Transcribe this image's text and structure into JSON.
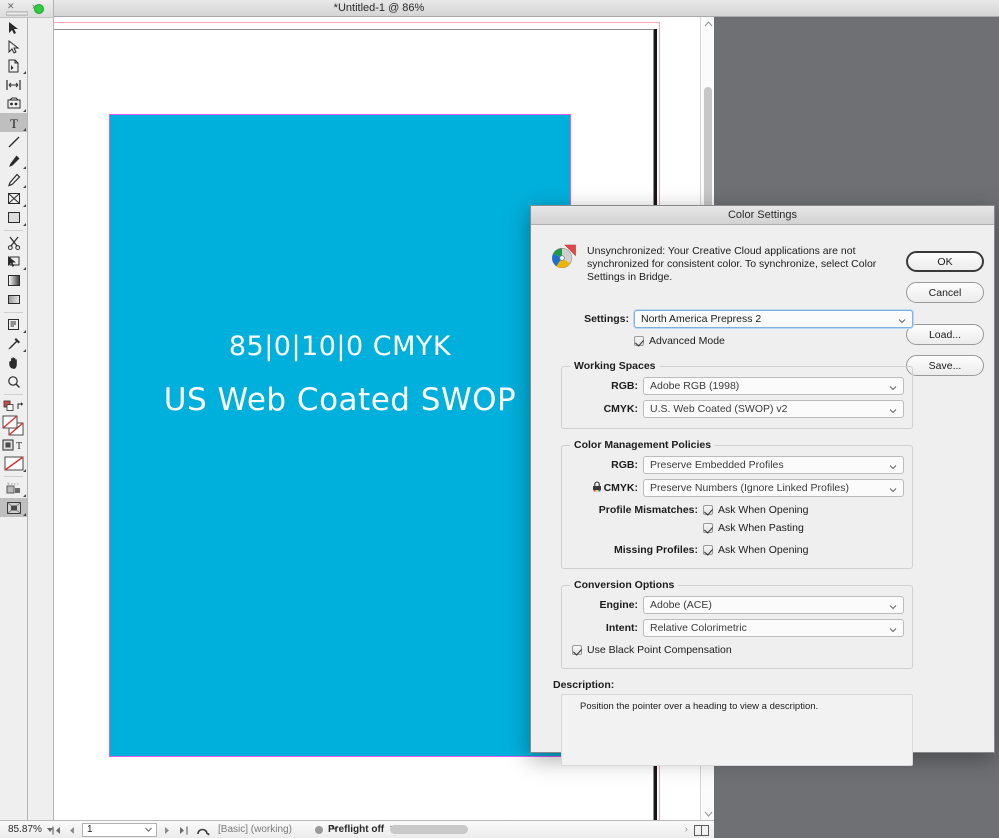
{
  "window": {
    "title": "*Untitled-1 @ 86%",
    "close_dot": "green-close-dot",
    "panel_collapse_x": "✕",
    "panel_expand": "»"
  },
  "canvas": {
    "artwork_line1": "85|0|10|0 CMYK",
    "artwork_line2": "US Web Coated SWOP",
    "rect_color": "#00b0dc",
    "selection_color": "#e45bf0",
    "bleed_color": "#f7a8b2"
  },
  "toolbar": {
    "items": [
      {
        "name": "selection-tool",
        "selected": false
      },
      {
        "name": "direct-selection-tool",
        "selected": false
      },
      {
        "name": "page-tool",
        "selected": false
      },
      {
        "name": "gap-tool",
        "selected": false
      },
      {
        "name": "content-collector-tool",
        "selected": false
      },
      {
        "name": "type-tool",
        "selected": true
      },
      {
        "name": "line-tool",
        "selected": false
      },
      {
        "name": "pen-tool",
        "selected": false
      },
      {
        "name": "pencil-tool",
        "selected": false
      },
      {
        "name": "frame-tool",
        "selected": false
      },
      {
        "name": "rectangle-tool",
        "selected": false
      },
      {
        "name": "scissors-tool",
        "selected": false
      },
      {
        "name": "free-transform-tool",
        "selected": false
      },
      {
        "name": "gradient-swatch-tool",
        "selected": false
      },
      {
        "name": "gradient-feather-tool",
        "selected": false
      },
      {
        "name": "note-tool",
        "selected": false
      },
      {
        "name": "eyedropper-tool",
        "selected": false
      },
      {
        "name": "hand-tool",
        "selected": false
      },
      {
        "name": "zoom-tool",
        "selected": false
      },
      {
        "name": "fill-stroke-swap",
        "selected": false
      },
      {
        "name": "fill-stroke-proxy",
        "selected": false
      },
      {
        "name": "formatting-affects-container",
        "selected": false
      },
      {
        "name": "apply-none-swatch",
        "selected": false
      },
      {
        "name": "normal-view-mode",
        "selected": false
      },
      {
        "name": "preview-mode",
        "selected": true
      }
    ]
  },
  "statusbar": {
    "zoom": "85.87%",
    "first_page": "⏮",
    "prev_page": "◀",
    "page_value": "1",
    "next_page": "▶",
    "last_page": "⏭",
    "style_label": "[Basic] (working)",
    "preflight": "Preflight off",
    "overflow": "‹"
  },
  "dialog": {
    "title": "Color Settings",
    "alert_icon": "color-wheel-icon",
    "alert_text": "Unsynchronized: Your Creative Cloud applications are not synchronized for consistent color. To synchronize, select Color Settings in Bridge.",
    "buttons": {
      "ok": "OK",
      "cancel": "Cancel",
      "load": "Load...",
      "save": "Save..."
    },
    "settings": {
      "label": "Settings:",
      "value": "North America Prepress 2",
      "advanced_mode_label": "Advanced Mode",
      "advanced_mode_checked": true
    },
    "working_spaces": {
      "legend": "Working Spaces",
      "rgb_label": "RGB:",
      "rgb_value": "Adobe RGB (1998)",
      "cmyk_label": "CMYK:",
      "cmyk_value": "U.S. Web Coated (SWOP) v2"
    },
    "color_management_policies": {
      "legend": "Color Management Policies",
      "rgb_label": "RGB:",
      "rgb_value": "Preserve Embedded Profiles",
      "cmyk_label": "CMYK:",
      "cmyk_value": "Preserve Numbers (Ignore Linked Profiles)",
      "cmyk_lock_icon": "lock-icon",
      "profile_mismatches_label": "Profile Mismatches:",
      "ask_when_opening_1": "Ask When Opening",
      "ask_when_opening_1_checked": true,
      "ask_when_pasting": "Ask When Pasting",
      "ask_when_pasting_checked": true,
      "missing_profiles_label": "Missing Profiles:",
      "ask_when_opening_2": "Ask When Opening",
      "ask_when_opening_2_checked": true
    },
    "conversion_options": {
      "legend": "Conversion Options",
      "engine_label": "Engine:",
      "engine_value": "Adobe (ACE)",
      "intent_label": "Intent:",
      "intent_value": "Relative Colorimetric",
      "bpc_label": "Use Black Point Compensation",
      "bpc_checked": true
    },
    "description": {
      "label": "Description:",
      "text": "Position the pointer over a heading to view a description."
    }
  }
}
